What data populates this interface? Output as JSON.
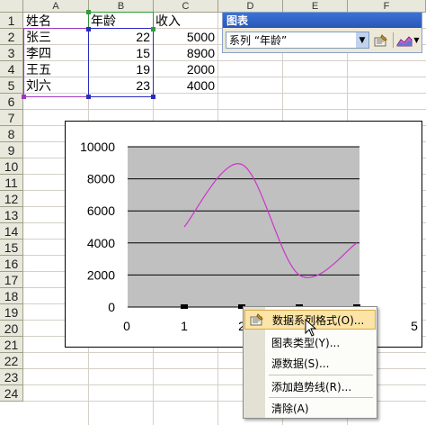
{
  "columns": [
    "A",
    "B",
    "C",
    "D",
    "E",
    "F"
  ],
  "rows": [
    "1",
    "2",
    "3",
    "4",
    "5",
    "6",
    "7",
    "8",
    "9",
    "10",
    "11",
    "12",
    "13",
    "14",
    "15",
    "16",
    "17",
    "18",
    "19",
    "20",
    "21",
    "22",
    "23",
    "24"
  ],
  "table": {
    "headers": [
      "姓名",
      "年龄",
      "收入"
    ],
    "records": [
      {
        "name": "张三",
        "age": "22",
        "income": "5000"
      },
      {
        "name": "李四",
        "age": "15",
        "income": "8900"
      },
      {
        "name": "王五",
        "age": "19",
        "income": "2000"
      },
      {
        "name": "刘六",
        "age": "23",
        "income": "4000"
      }
    ]
  },
  "chart_toolbar": {
    "title": "图表",
    "series_select": "系列 “年龄”",
    "format_icon": "format-series-icon",
    "chart_type_icon": "chart-type-icon"
  },
  "chart_data": {
    "type": "scatter",
    "smooth": true,
    "x": [
      1,
      2,
      3,
      4
    ],
    "y": [
      5000,
      8900,
      2000,
      4000
    ],
    "xlim": [
      0,
      5
    ],
    "ylim": [
      0,
      10000
    ],
    "x_ticks": [
      "0",
      "1",
      "2",
      "3",
      "4",
      "5"
    ],
    "y_ticks": [
      "0",
      "2000",
      "4000",
      "6000",
      "8000",
      "10000"
    ],
    "grid": "horizontal",
    "line_color": "#cc33cc",
    "plot_bg": "#c0c0c0"
  },
  "context_menu": {
    "items": [
      {
        "label": "数据系列格式(O)...",
        "highlighted": true,
        "icon": "format-icon"
      },
      {
        "label": "图表类型(Y)...",
        "highlighted": false
      },
      {
        "label": "源数据(S)...",
        "highlighted": false
      },
      {
        "label": "添加趋势线(R)...",
        "highlighted": false
      },
      {
        "label": "清除(A)",
        "highlighted": false
      }
    ]
  }
}
